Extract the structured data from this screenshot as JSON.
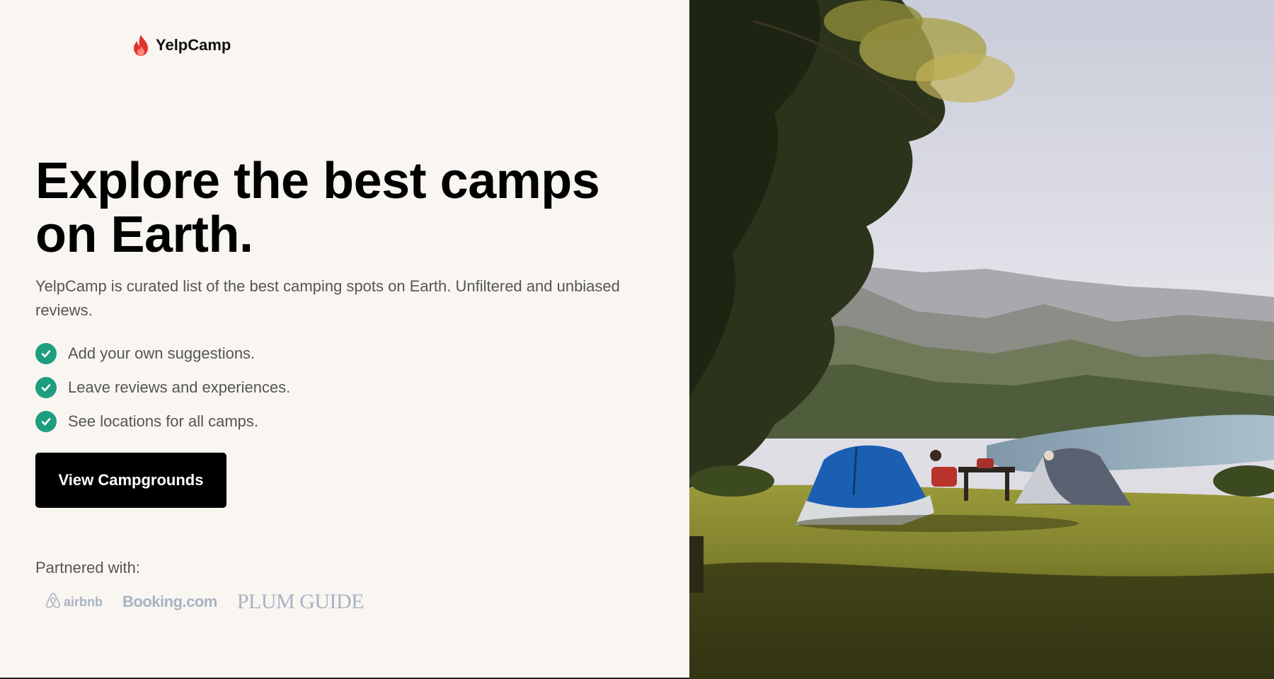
{
  "brand": {
    "name": "YelpCamp",
    "icon": "flame-icon",
    "icon_color": "#e0332b"
  },
  "hero": {
    "headline_line1": "Explore the best camps",
    "headline_line2": "on Earth.",
    "description": "YelpCamp is curated list of the best camping spots on Earth. Unfiltered and unbiased reviews.",
    "features": [
      "Add your own suggestions.",
      "Leave reviews and experiences.",
      "See locations for all camps."
    ],
    "feature_icon": "check-circle-icon",
    "check_color": "#1d9e7f",
    "cta_label": "View Campgrounds"
  },
  "partners": {
    "label": "Partnered with:",
    "logos": [
      "airbnb",
      "Booking.com",
      "PLUM GUIDE"
    ]
  },
  "colors": {
    "background": "#f9f6f1",
    "button": "#000000",
    "logo_gray": "#a9b3c5"
  }
}
